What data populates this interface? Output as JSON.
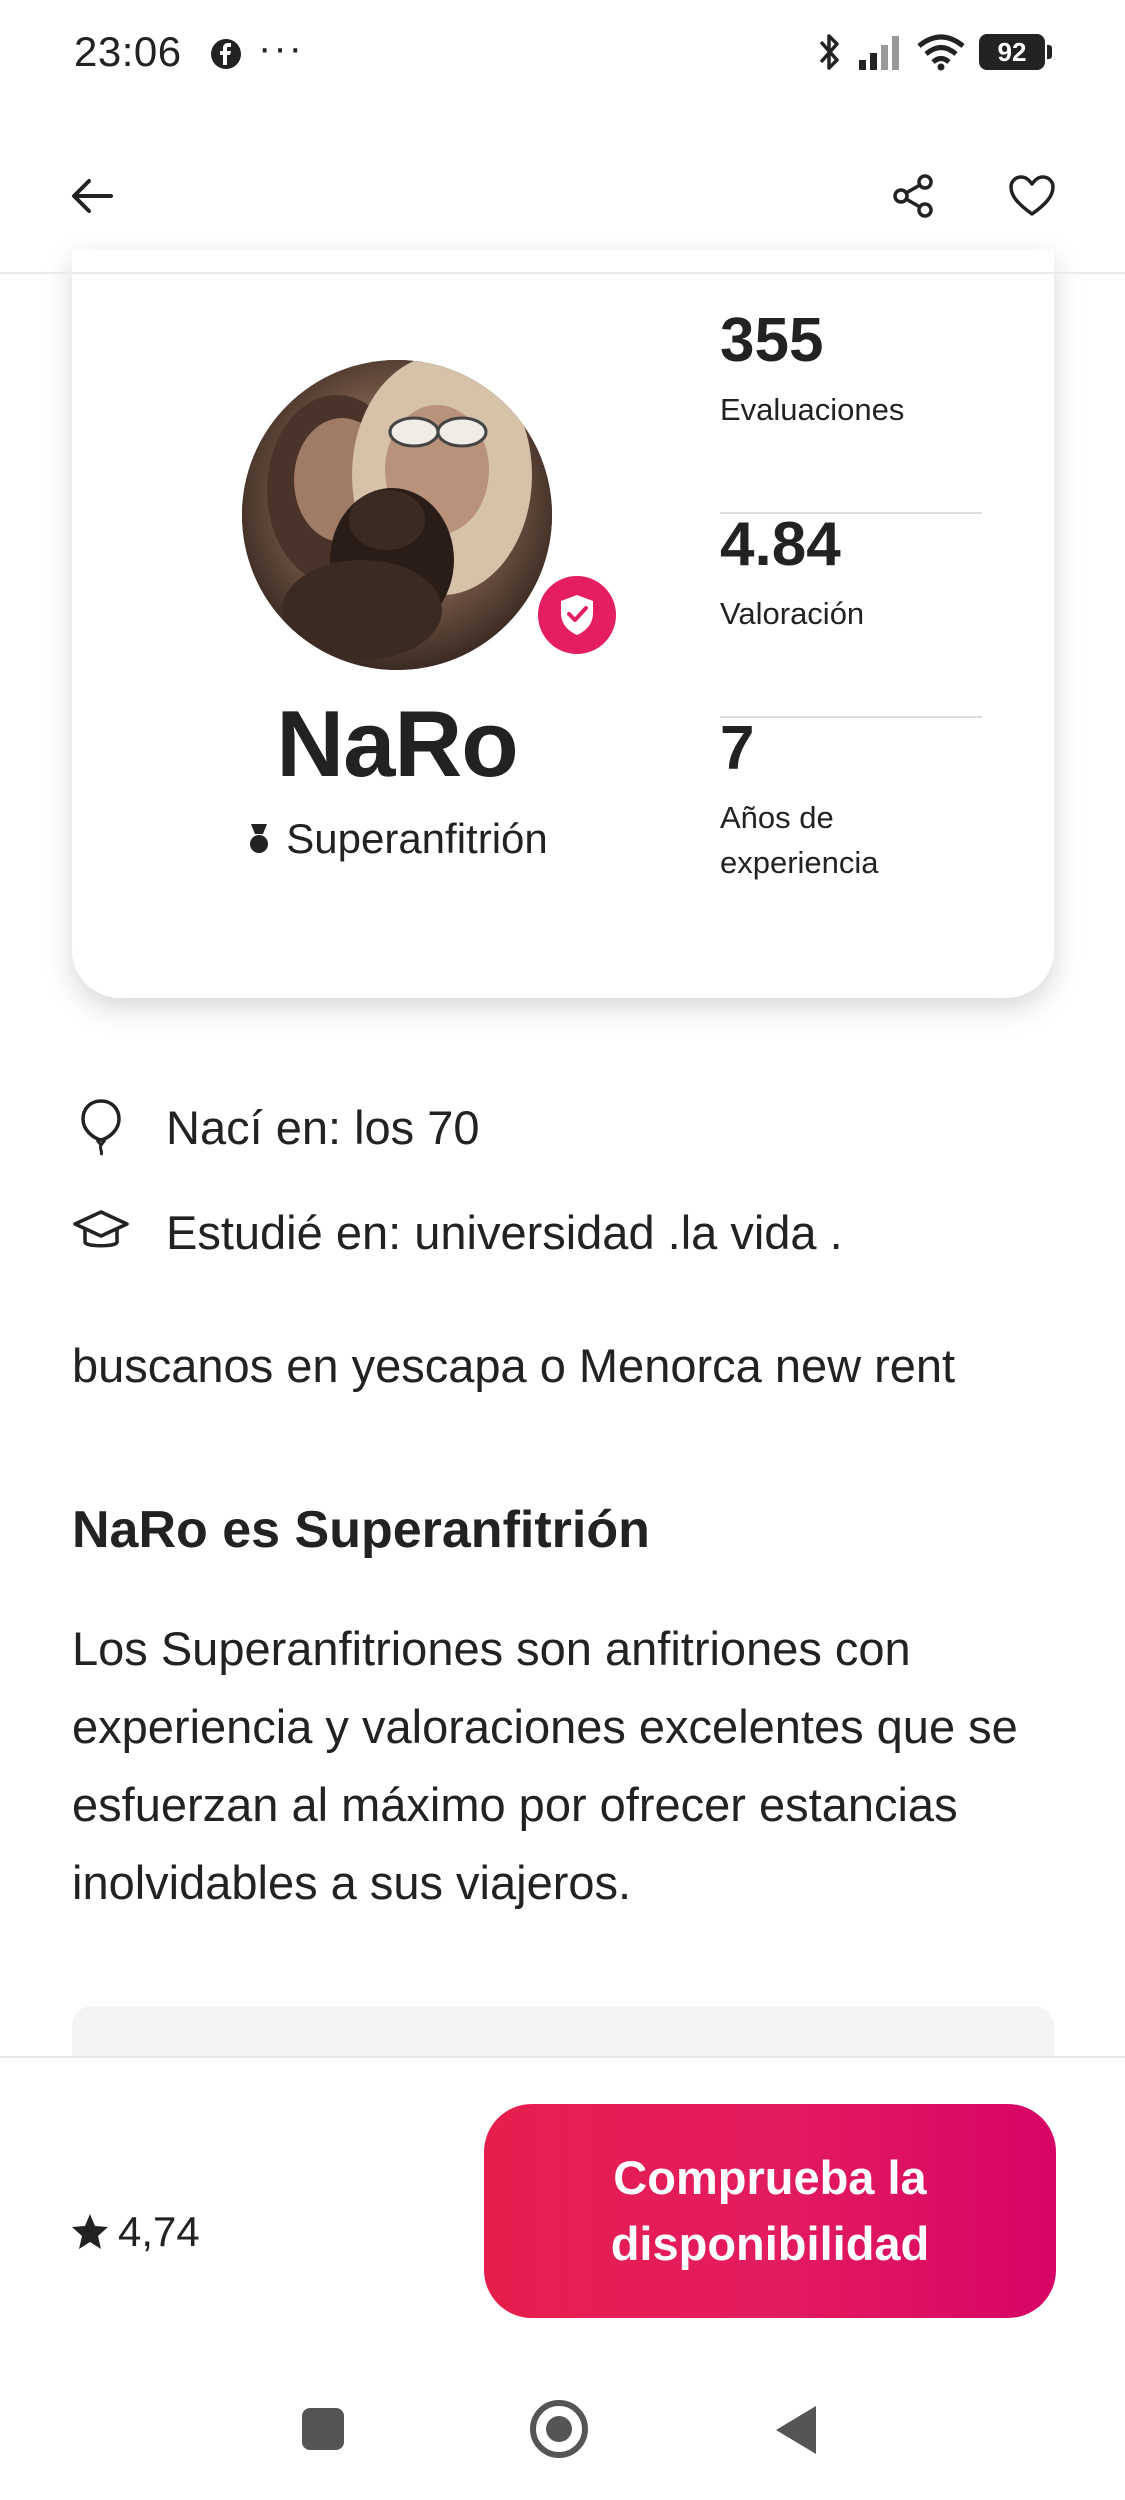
{
  "status_bar": {
    "time": "23:06",
    "dots": "···",
    "battery": "92"
  },
  "icons": {
    "back": "arrow-left-icon",
    "share": "share-icon",
    "favorite": "heart-icon",
    "verified": "shield-check-icon",
    "superhost": "superhost-medal-icon",
    "born": "balloon-icon",
    "studied": "graduation-cap-icon",
    "rating": "star-icon"
  },
  "colors": {
    "accent": "#e31c5f",
    "text": "#222222"
  },
  "profile": {
    "name": "NaRo",
    "badge": "Superanfitrión",
    "stats": [
      {
        "value": "355",
        "label": "Evaluaciones"
      },
      {
        "value": "4.84",
        "label": "Valoración"
      },
      {
        "value": "7",
        "label": "Años de experiencia"
      }
    ]
  },
  "details": {
    "born": "Nací en: los 70",
    "studied": "Estudié en: universidad .la vida ."
  },
  "about": "buscanos en yescapa  o Menorca new rent",
  "superhost_section": {
    "title": "NaRo es Superanfitrión",
    "body": "Los Superanfitriones son anfitriones con experiencia y valoraciones excelentes que se esfuerzan al máximo por ofrecer estancias inolvidables a sus viajeros."
  },
  "footer": {
    "rating": "4,74",
    "cta": "Comprueba la disponibilidad"
  }
}
